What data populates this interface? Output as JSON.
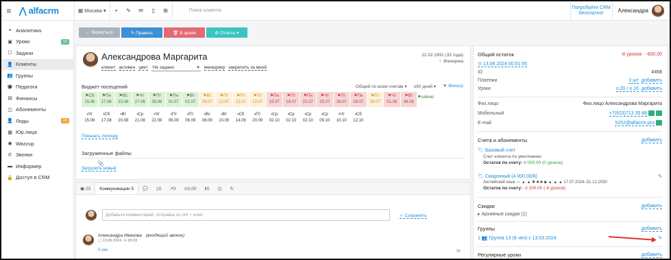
{
  "topbar": {
    "logo": "alfacrm",
    "branch": "Москва",
    "search_placeholder": "Поиск клиента",
    "try_crm": "Попробуйте CRM бесплатно!",
    "user": "Александра"
  },
  "sidebar": {
    "items": [
      {
        "label": "Аналитика",
        "icon": "≡"
      },
      {
        "label": "Уроки",
        "icon": "▣",
        "badge": "12",
        "badge_color": "#67c18c"
      },
      {
        "label": "Задачи",
        "icon": "☐"
      },
      {
        "label": "Клиенты",
        "icon": "👤",
        "active": true
      },
      {
        "label": "Группы",
        "icon": "👥"
      },
      {
        "label": "Педагоги",
        "icon": "🎓"
      },
      {
        "label": "Финансы",
        "icon": "▤"
      },
      {
        "label": "Абонементы",
        "icon": "◫"
      },
      {
        "label": "Лиды",
        "icon": "👤",
        "badge": "23",
        "badge_color": "#f0a43a"
      },
      {
        "label": "Юр.лица",
        "icon": "▦"
      },
      {
        "label": "Wazzup",
        "icon": "◉"
      },
      {
        "label": "Звонки",
        "icon": "✆"
      },
      {
        "label": "Информер",
        "icon": "▬"
      },
      {
        "label": "Доступ в CRM",
        "icon": "🔒"
      }
    ]
  },
  "actions": [
    {
      "label": "← Вернуться",
      "color": "#a9b1bb"
    },
    {
      "label": "✎ Править",
      "color": "#3d8fd6"
    },
    {
      "label": "🗑 В архив",
      "color": "#e36a75"
    },
    {
      "label": "⚙ Отчеты ▾",
      "color": "#3cc4c1"
    }
  ],
  "profile": {
    "name": "Александрова Маргарита",
    "tags": [
      "клиент",
      "активен",
      "цвет"
    ],
    "status_select": "Не задано",
    "manager_link": "менеджер",
    "pin_link": "закрепить за мной",
    "dob": "12.02.1991 (33 года)",
    "gender": "♀ Женщина"
  },
  "visits": {
    "title": "Виджет посещений",
    "accounts": "Общий по всем счетам ▾",
    "period": "±90 дней ▾",
    "filter": "▼ Фильтр",
    "row1": [
      {
        "d": "Сб",
        "n": "15.06",
        "s": "g"
      },
      {
        "d": "Пн",
        "n": "17.06",
        "s": "g"
      },
      {
        "d": "Вс",
        "n": "23.06",
        "s": "g"
      },
      {
        "d": "Чт",
        "n": "27.06",
        "s": "g"
      },
      {
        "d": "Пт",
        "n": "28.06",
        "s": "g"
      },
      {
        "d": "Пн",
        "n": "01.07",
        "s": "g"
      },
      {
        "d": "Вт",
        "n": "02.07",
        "s": "g"
      },
      {
        "d": "Вт",
        "n": "09.07",
        "s": "o"
      },
      {
        "d": "Пт",
        "n": "12.07",
        "s": "o"
      },
      {
        "d": "Пт",
        "n": "12.07",
        "s": "o"
      },
      {
        "d": "Пт",
        "n": "12.07",
        "s": "o"
      },
      {
        "d": "Пн",
        "n": "15.07",
        "s": "r"
      },
      {
        "d": "Пт",
        "n": "19.07",
        "s": "r"
      },
      {
        "d": "Пн",
        "n": "22.07",
        "s": "r"
      },
      {
        "d": "Чт",
        "n": "25.07",
        "s": "r"
      },
      {
        "d": "Пт",
        "n": "26.07",
        "s": "r"
      },
      {
        "d": "Пн",
        "n": "29.07",
        "s": "r"
      },
      {
        "d": "Пт",
        "n": "29.07",
        "s": "o"
      },
      {
        "d": "Чт",
        "n": "01.08",
        "s": "r"
      },
      {
        "d": "Вт",
        "n": "06.08",
        "s": "r"
      }
    ],
    "now": "сейчас",
    "row2": [
      {
        "d": "Чт",
        "n": "15.08"
      },
      {
        "d": "Сб",
        "n": "17.08"
      },
      {
        "d": "Вт",
        "n": "20.08"
      },
      {
        "d": "Ср",
        "n": "21.08"
      },
      {
        "d": "Чт",
        "n": "22.08"
      },
      {
        "d": "Пт",
        "n": "06.09"
      },
      {
        "d": "Пт",
        "n": "06.09"
      },
      {
        "d": "Вс",
        "n": "08.09"
      },
      {
        "d": "Вт",
        "n": "10.09"
      },
      {
        "d": "Сб",
        "n": "14.09"
      },
      {
        "d": "Пт",
        "n": "20.09"
      },
      {
        "d": "Ср",
        "n": "02.10"
      },
      {
        "d": "Ср",
        "n": "02.10"
      },
      {
        "d": "Ср",
        "n": "02.10"
      },
      {
        "d": "Ср",
        "n": "09.10"
      },
      {
        "d": "Чт",
        "n": "10.10"
      },
      {
        "d": "Сб",
        "n": "12.10"
      }
    ],
    "legend": "Показать легенду"
  },
  "files": {
    "title": "Загруженные файлы",
    "upload": "Загрузить новый"
  },
  "comms": {
    "tabs": [
      "▣ 23",
      "Коммуникации 5",
      "💬",
      "▯0",
      "↗0",
      "⊙0,00",
      "Ⅱ0",
      "◫",
      "↻"
    ],
    "placeholder": "Добавьте комментарий, отправка по ctrl + enter",
    "save": "✓ Сохранить",
    "author": "Александра Иванова",
    "note": "(входящий звонок)",
    "date": "▢ 13.06.2024",
    "time": "⊙ 00:33",
    "duration": "0 сек",
    "sync": "⟳"
  },
  "right": {
    "balance_title": "Общий остаток",
    "balance_value": "-8 уроков · -800,00",
    "balance_date": "⊙ 13.08.2024 00:51:55",
    "id_label": "ID",
    "id_value": "#458",
    "payments_label": "Платежи",
    "payments_value": "3 шт",
    "payments_add": "добавить",
    "lessons_label": "Уроки",
    "lessons_value": "л.20 / о.16",
    "lessons_add": "добавить",
    "person_label": "Физ.лицо",
    "person_value": "Физ.лицо Александрова Маргарита",
    "mobile_label": "Мобильный",
    "mobile_value": "+7(923)713 35 88",
    "email_label": "E-mail",
    "email_value": "5252@alfacrm.pro",
    "accounts_title": "Счета и абонементы",
    "accounts_add": "добавить",
    "acc1_title": "🏷 Базовый счет",
    "acc1_sub": "Счет клиента по умолчанию",
    "acc1_rest_label": "Остаток по счету:",
    "acc1_rest": "4 000,00 (0 уроков)",
    "acc2_title": "🏷 Скидочный (4 000,00/8)",
    "acc2_sub": "Английский язык — ▲ ▲ ✱ ■ ■ ◆ ▲ ▲ ▲   17.07.2024–31.12.2030",
    "acc2_rest_label": "Остаток по счету:",
    "acc2_rest": "-3 200,00 (-8 уроков)",
    "discounts_title": "Скидки",
    "discounts_add": "добавить",
    "discounts_archive": "▸ Архивные скидки (1)",
    "groups_title": "Группы",
    "groups_add": "добавить",
    "group_line": "1 👥 Группа 13 (8 чел) с 13.03.2024",
    "regular_title": "Регулярные уроки",
    "regular_add": "добавить"
  }
}
